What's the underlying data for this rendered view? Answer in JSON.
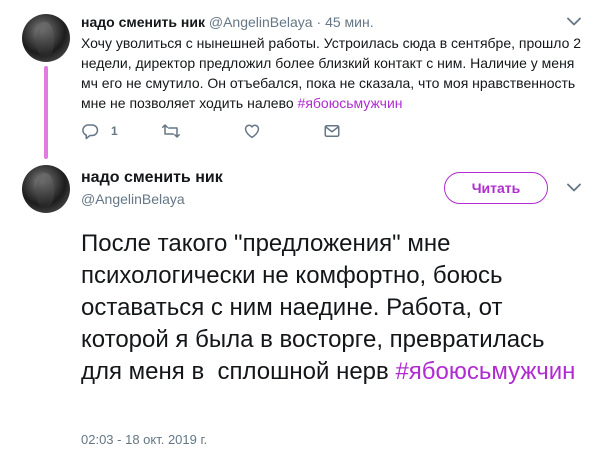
{
  "parent_tweet": {
    "name": "надо сменить ник",
    "handle": "@AngelinBelaya",
    "separator": "·",
    "time": "45 мин.",
    "text": "Хочу уволиться с нынешней работы. Устроилась сюда в сентябре, прошло 2 недели, директор предложил более близкий контакт с ним. Наличие у меня мч его не смутило. Он отъебался, пока не сказала, что моя нравственность мне не позволяет ходить налево ",
    "hashtag": "#ябоюсьмужчин",
    "reply_count": "1",
    "icons": [
      "reply-icon",
      "retweet-icon",
      "like-icon",
      "message-icon",
      "chevron-down-icon"
    ]
  },
  "main_tweet": {
    "name": "надо сменить ник",
    "handle": "@AngelinBelaya",
    "follow_label": "Читать",
    "text": "После такого \"предложения\" мне психологически не комфортно, боюсь оставаться с ним наедине. Работа, от которой я была в восторге, превратилась для меня в  сплошной нерв ",
    "hashtag": "#ябоюсьмужчин",
    "date": "02:03 - 18 окт. 2019 г."
  },
  "colors": {
    "accent": "#b02cd1",
    "thread_line": "#e07be0",
    "text": "#14171a",
    "muted": "#657786"
  }
}
